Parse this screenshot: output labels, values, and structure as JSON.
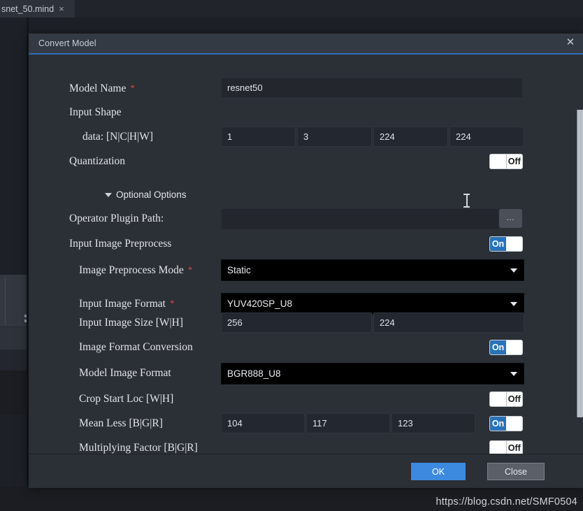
{
  "workspace": {
    "tab": {
      "label": "snet_50.mind",
      "close_icon": "close-icon",
      "close_glyph": "×"
    }
  },
  "dialog": {
    "title": "Convert Model",
    "close_glyph": "✕",
    "footer": {
      "ok_label": "OK",
      "close_label": "Close"
    },
    "collapsible_section": {
      "label": "Optional Options",
      "expanded": true
    },
    "required_marker": "*",
    "browse_label": "…",
    "rows": [
      {
        "name": "model-name",
        "label": "Model Name",
        "required": true,
        "type": "text",
        "value": "resnet50"
      },
      {
        "name": "input-shape",
        "label": "Input Shape",
        "required": false,
        "type": "header"
      },
      {
        "name": "data-nchw",
        "label": "data:  [N|C|H|W]",
        "required": false,
        "type": "multi-text",
        "values": [
          "1",
          "3",
          "224",
          "224"
        ]
      },
      {
        "name": "quantization",
        "label": "Quantization",
        "required": false,
        "type": "toggle",
        "state": "Off"
      },
      {
        "name": "operator-plugin-path",
        "label": "Operator Plugin Path:",
        "required": false,
        "type": "text-browse",
        "value": ""
      },
      {
        "name": "input-image-preprocess",
        "label": "Input Image Preprocess",
        "required": false,
        "type": "toggle",
        "state": "On"
      },
      {
        "name": "image-preprocess-mode",
        "label": "Image Preprocess Mode",
        "required": true,
        "type": "select",
        "value": "Static"
      },
      {
        "name": "input-image-format",
        "label": "Input Image Format",
        "required": true,
        "type": "select",
        "value": "YUV420SP_U8"
      },
      {
        "name": "input-image-size",
        "label": "Input Image Size [W|H]",
        "required": false,
        "type": "multi-text",
        "values": [
          "256",
          "224"
        ]
      },
      {
        "name": "image-format-conversion",
        "label": "Image Format Conversion",
        "required": false,
        "type": "toggle",
        "state": "On"
      },
      {
        "name": "model-image-format",
        "label": "Model Image Format",
        "required": false,
        "type": "select",
        "value": "BGR888_U8"
      },
      {
        "name": "crop-start-loc",
        "label": "Crop Start Loc [W|H]",
        "required": false,
        "type": "toggle",
        "state": "Off"
      },
      {
        "name": "mean-less",
        "label": "Mean Less [B|G|R]",
        "required": false,
        "type": "multi-text-toggle",
        "values": [
          "104",
          "117",
          "123"
        ],
        "state": "On"
      },
      {
        "name": "multiplying-factor",
        "label": "Multiplying Factor [B|G|R]",
        "required": false,
        "type": "toggle",
        "state": "Off"
      }
    ]
  },
  "watermark": {
    "text": "https://blog.csdn.net/SMF0504"
  },
  "colors": {
    "accent_blue": "#3c8ae0",
    "title_underline": "#2d6fb5",
    "toggle_on": "#2a72b8",
    "required_red": "#e8453c",
    "dialog_bg": "#2b2f36",
    "field_bg": "#232730",
    "combo_bg": "#000000"
  }
}
